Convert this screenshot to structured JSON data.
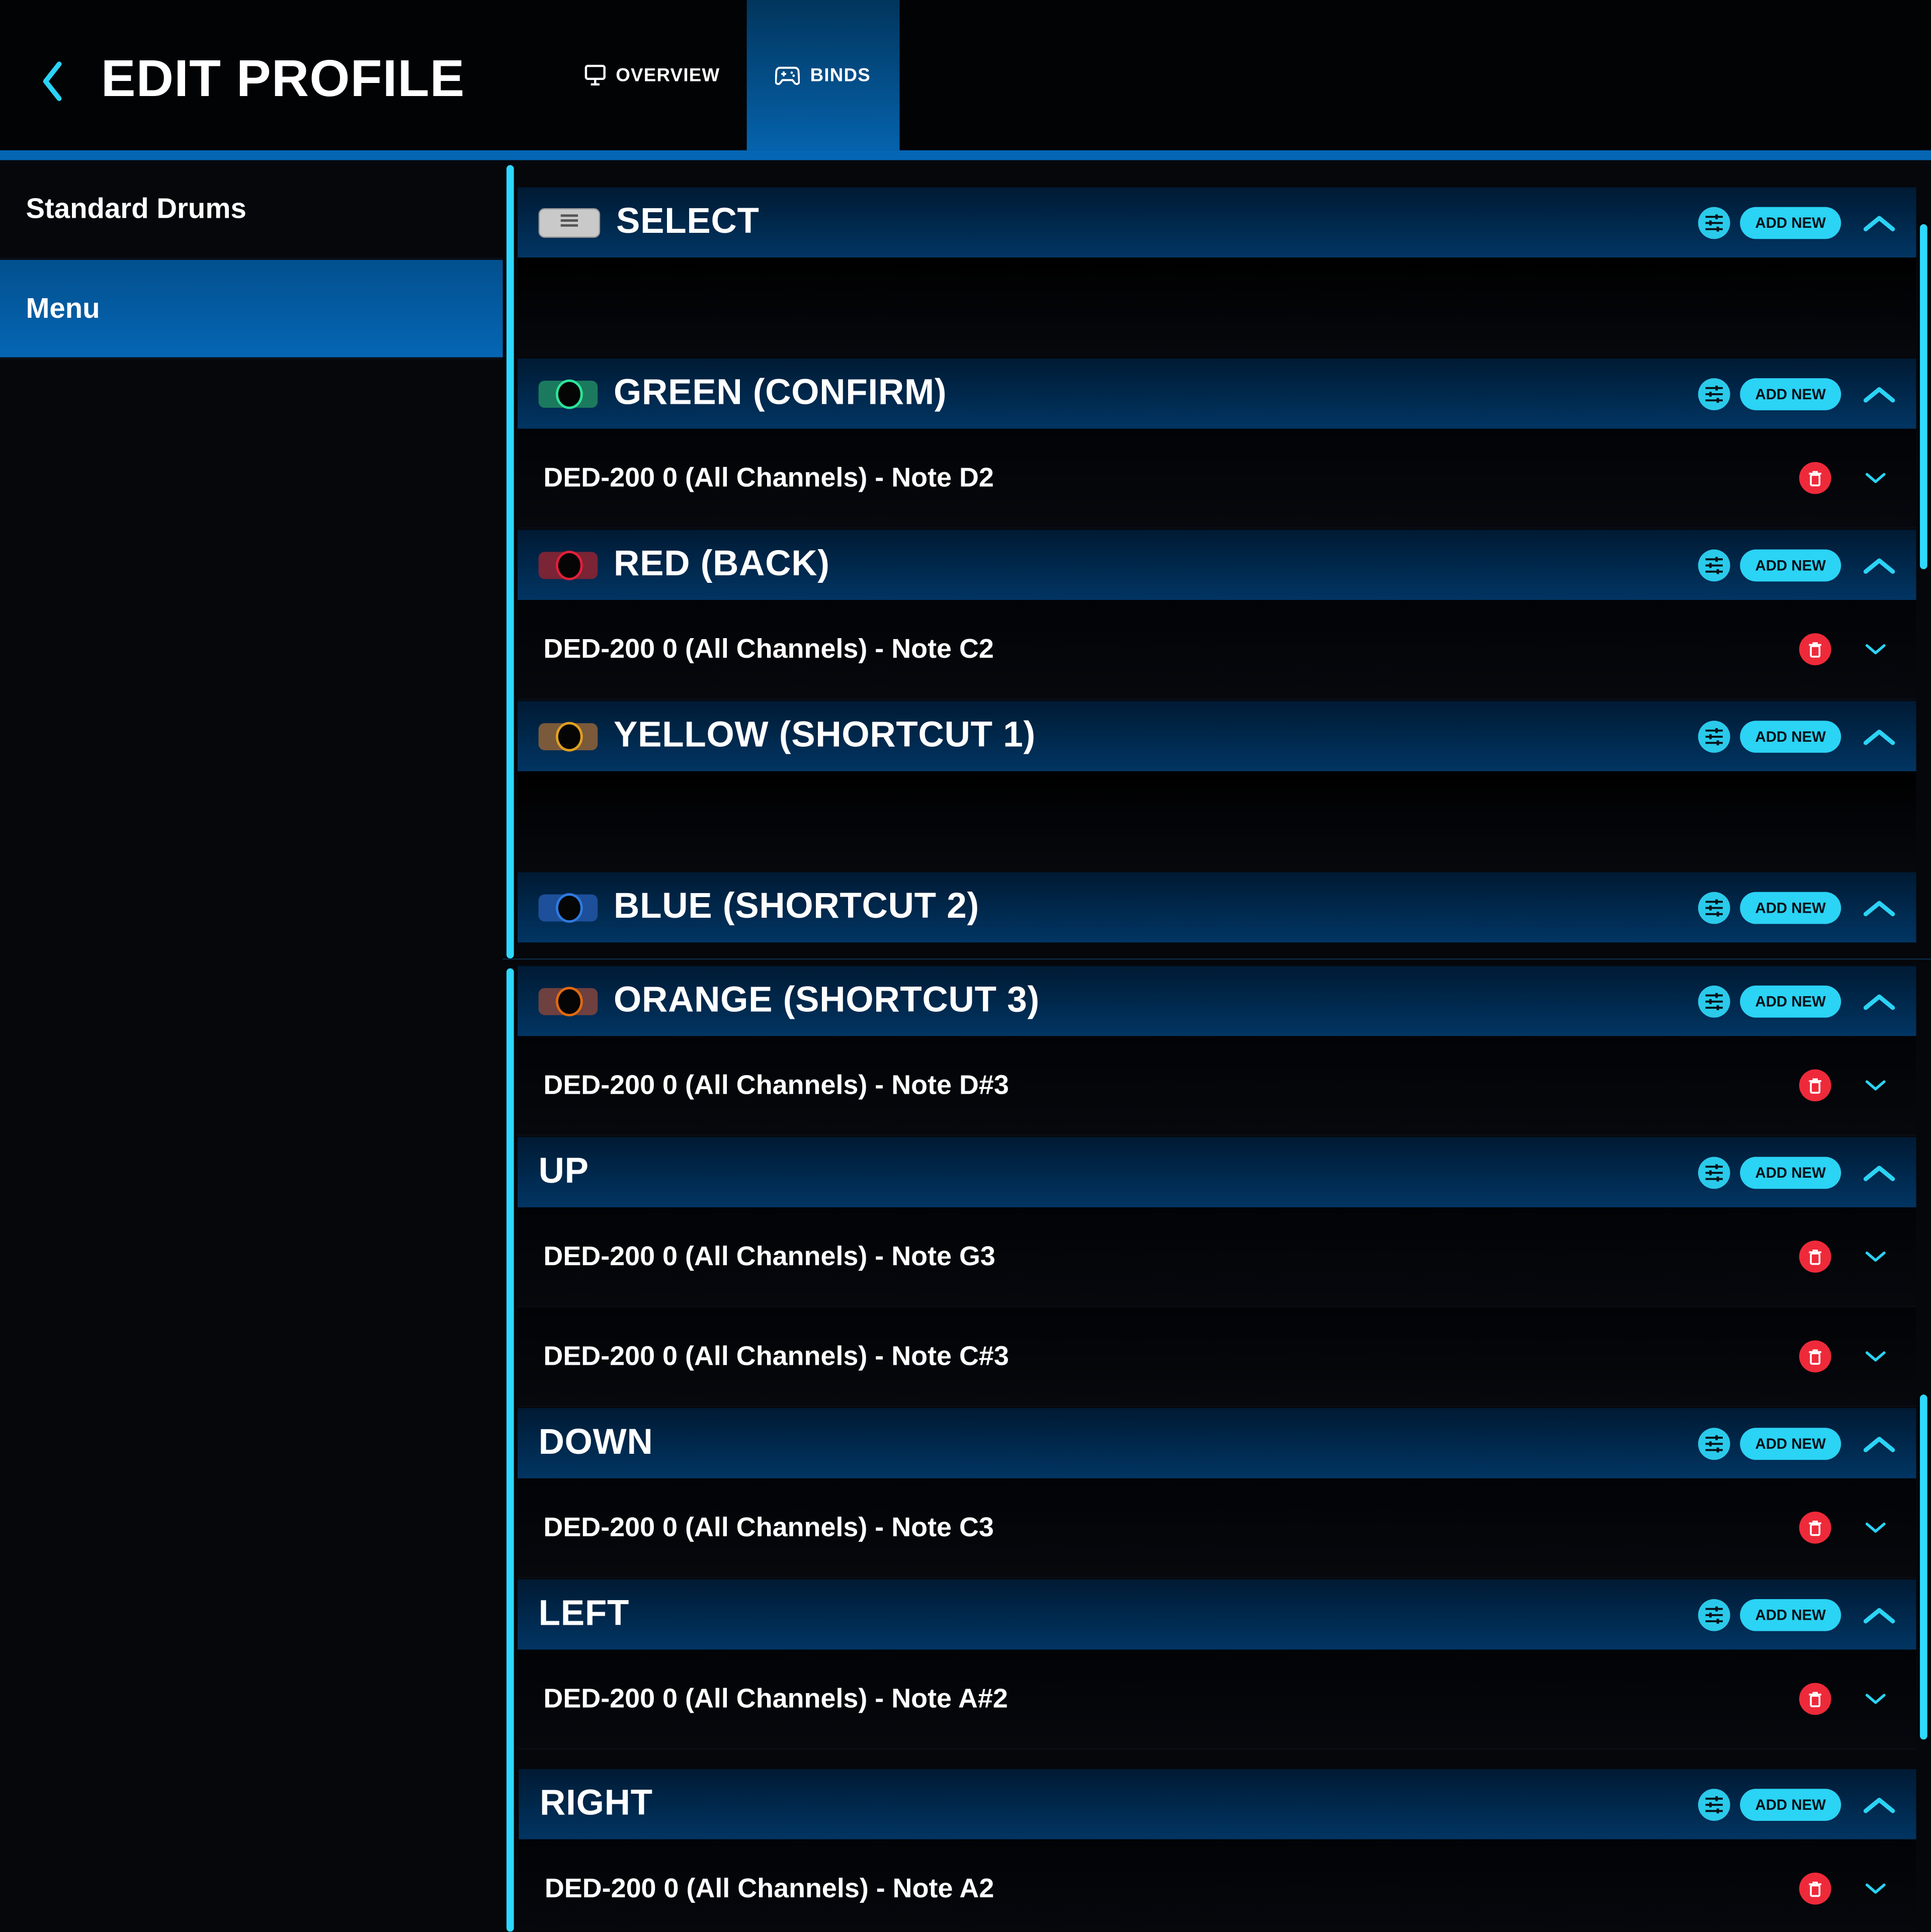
{
  "header": {
    "title": "EDIT PROFILE",
    "back_icon": "chevron-left-icon"
  },
  "tabs": [
    {
      "label": "OVERVIEW",
      "icon": "monitor-icon",
      "active": false
    },
    {
      "label": "BINDS",
      "icon": "gamepad-icon",
      "active": true
    }
  ],
  "sidebar": {
    "items": [
      {
        "label": "Standard Drums",
        "active": false
      },
      {
        "label": "Menu",
        "active": true
      }
    ]
  },
  "colors": {
    "accent": "#2bd3f5",
    "tab_active": "#0566b4",
    "delete": "#ee2a3a"
  },
  "section_actions": {
    "add_new_label": "ADD NEW"
  },
  "panels": [
    {
      "sections": [
        {
          "name": "SELECT",
          "swatch": "menu",
          "binds": []
        },
        {
          "name": "GREEN (CONFIRM)",
          "swatch": {
            "bg": "#1b7a5e",
            "ring": "#2ee39a"
          },
          "binds": [
            "DED-200 0 (All Channels) - Note D2"
          ]
        },
        {
          "name": "RED (BACK)",
          "swatch": {
            "bg": "#7a2436",
            "ring": "#e0203a"
          },
          "binds": [
            "DED-200 0 (All Channels) - Note C2"
          ]
        },
        {
          "name": "YELLOW (SHORTCUT 1)",
          "swatch": {
            "bg": "#7a5a3a",
            "ring": "#e0a020"
          },
          "binds": []
        },
        {
          "name": "BLUE (SHORTCUT 2)",
          "swatch": {
            "bg": "#1d4f9a",
            "ring": "#2e7ae0"
          },
          "binds": null
        }
      ]
    },
    {
      "sections": [
        {
          "name": "ORANGE (SHORTCUT 3)",
          "swatch": {
            "bg": "#6e4040",
            "ring": "#e06a10"
          },
          "binds": [
            "DED-200 0 (All Channels) - Note D#3"
          ]
        },
        {
          "name": "UP",
          "swatch": null,
          "binds": [
            "DED-200 0 (All Channels) - Note G3",
            "DED-200 0 (All Channels) - Note C#3"
          ]
        },
        {
          "name": "DOWN",
          "swatch": null,
          "binds": [
            "DED-200 0 (All Channels) - Note C3"
          ]
        },
        {
          "name": "LEFT",
          "swatch": null,
          "binds": [
            "DED-200 0 (All Channels) - Note A#2"
          ]
        },
        {
          "name": "RIGHT",
          "swatch": null,
          "binds": [
            "DED-200 0 (All Channels) - Note A2"
          ]
        }
      ]
    }
  ]
}
